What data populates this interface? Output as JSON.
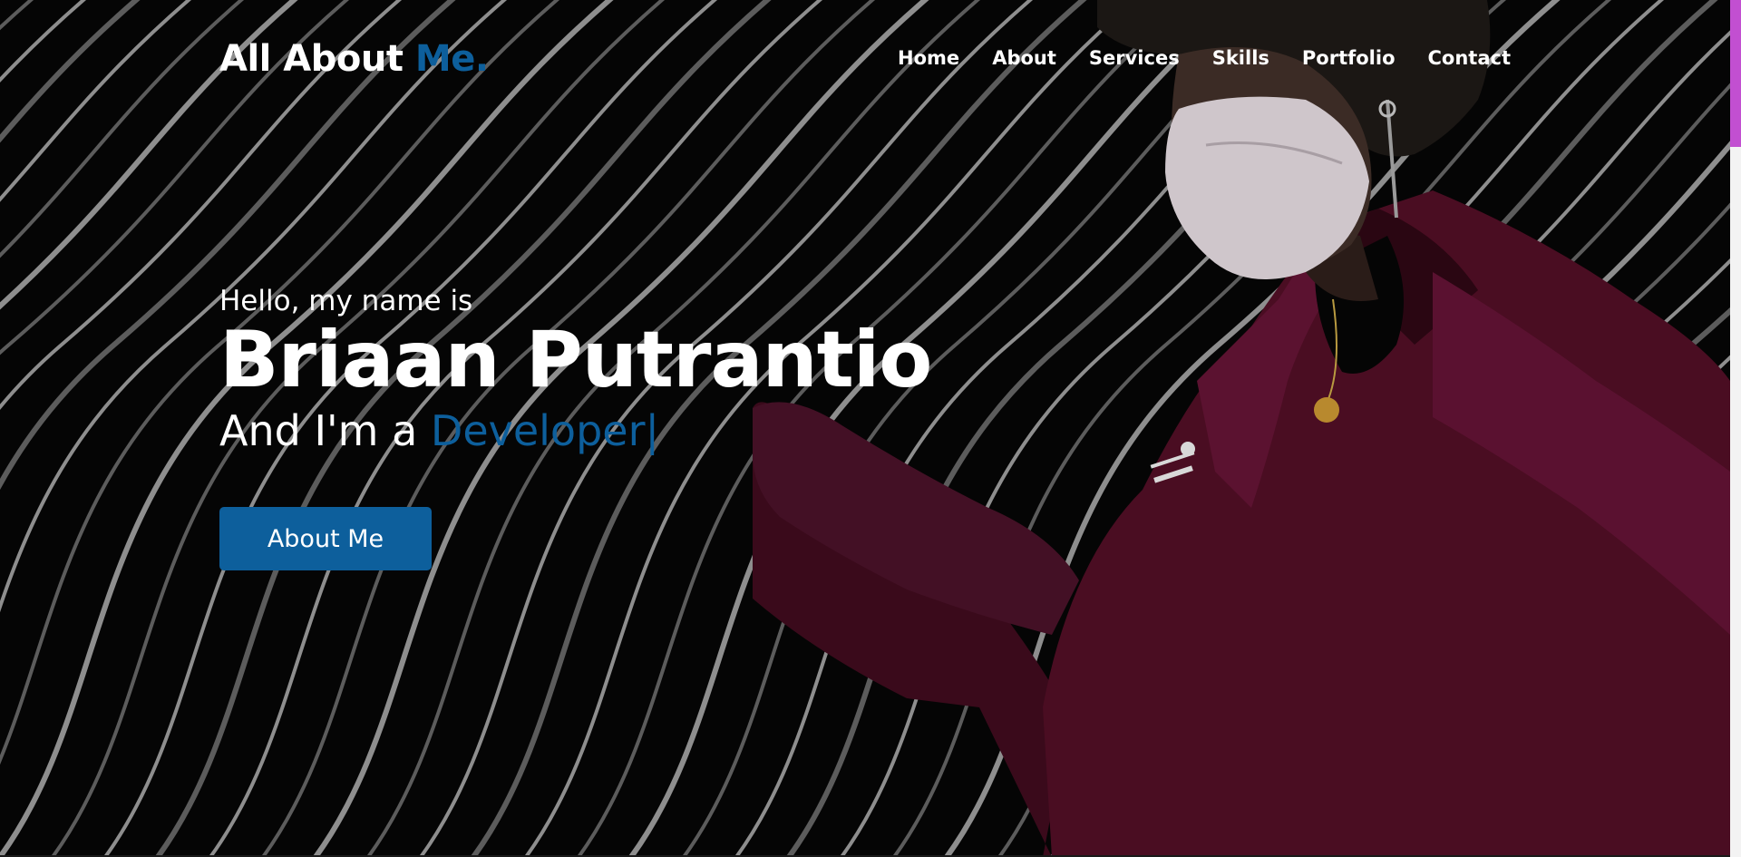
{
  "header": {
    "logo_text": "All About ",
    "logo_accent": "Me.",
    "nav": [
      "Home",
      "About",
      "Services",
      "Skills",
      "Portfolio",
      "Contact"
    ]
  },
  "hero": {
    "greeting": "Hello, my name is",
    "name": "Briaan Putrantio",
    "role_prefix": "And I'm a ",
    "role_typed": "Developer|",
    "cta_label": "About Me"
  },
  "colors": {
    "accent": "#0d5f9c",
    "background": "#050505",
    "text": "#ffffff",
    "jacket": "#4a0d22",
    "scroll_thumb": "#c24fd1"
  },
  "icons": [
    "wave-background",
    "person-photo"
  ]
}
